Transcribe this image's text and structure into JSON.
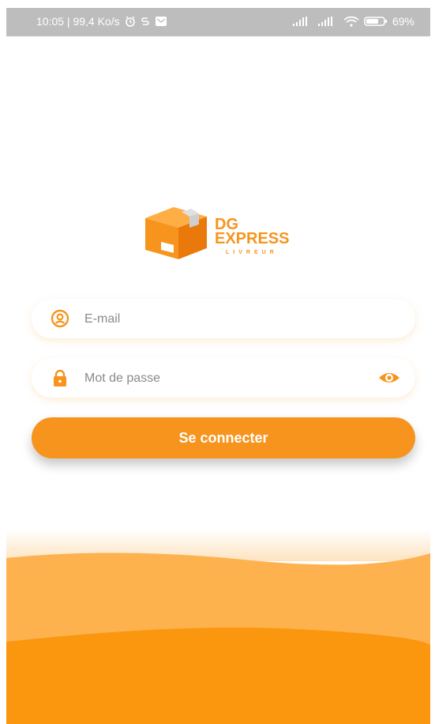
{
  "status_bar": {
    "time_speed": "10:05 | 99,4 Ko/s",
    "battery": "69"
  },
  "brand": {
    "line1": "DG",
    "line2": "EXPRESS",
    "tagline": "LIVREUR",
    "color": "#f7941d"
  },
  "form": {
    "email_placeholder": "E-mail",
    "password_placeholder": "Mot de passe",
    "email_value": "",
    "password_value": "",
    "login_label": "Se connecter"
  },
  "icons": {
    "email": "user-circle-icon",
    "password": "lock-icon",
    "toggle": "eye-icon"
  },
  "colors": {
    "accent": "#f7941d",
    "wave_light": "#fdb24f",
    "wave_mid": "#f9a23a",
    "wave_dark": "#fb960f"
  }
}
